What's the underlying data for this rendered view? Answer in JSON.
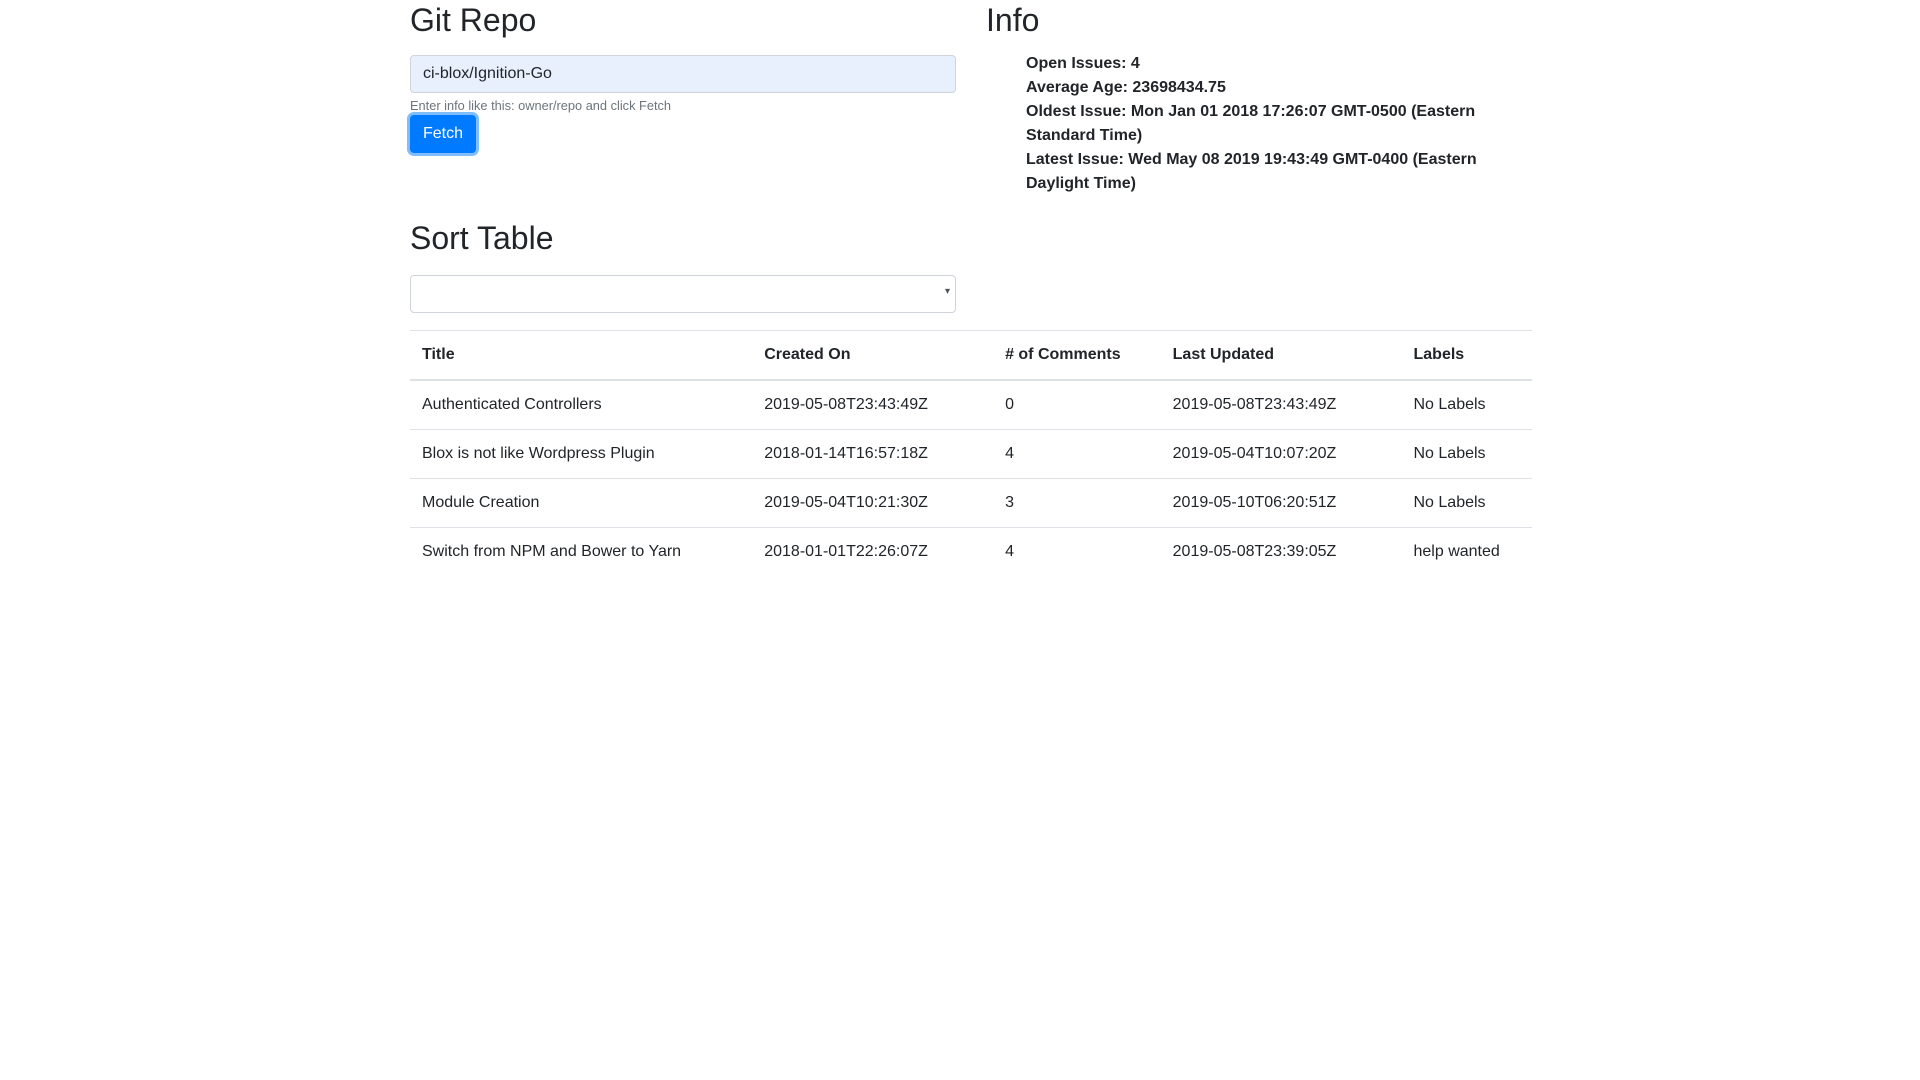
{
  "repo": {
    "title": "Git Repo",
    "input_value": "ci-blox/Ignition-Go",
    "help_text": "Enter info like this: owner/repo and click Fetch",
    "fetch_label": "Fetch"
  },
  "info": {
    "title": "Info",
    "open_issues": "Open Issues: 4",
    "average_age": "Average Age: 23698434.75",
    "oldest_issue": "Oldest Issue: Mon Jan 01 2018 17:26:07 GMT-0500 (Eastern Standard Time)",
    "latest_issue": "Latest Issue: Wed May 08 2019 19:43:49 GMT-0400 (Eastern Daylight Time)"
  },
  "sort": {
    "title": "Sort Table",
    "selected": ""
  },
  "table": {
    "headers": [
      "Title",
      "Created On",
      "# of Comments",
      "Last Updated",
      "Labels"
    ],
    "rows": [
      [
        "Authenticated Controllers",
        "2019-05-08T23:43:49Z",
        "0",
        "2019-05-08T23:43:49Z",
        "No Labels"
      ],
      [
        "Blox is not like Wordpress Plugin",
        "2018-01-14T16:57:18Z",
        "4",
        "2019-05-04T10:07:20Z",
        "No Labels"
      ],
      [
        "Module Creation",
        "2019-05-04T10:21:30Z",
        "3",
        "2019-05-10T06:20:51Z",
        "No Labels"
      ],
      [
        "Switch from NPM and Bower to Yarn",
        "2018-01-01T22:26:07Z",
        "4",
        "2019-05-08T23:39:05Z",
        "help wanted"
      ]
    ]
  },
  "colors": {
    "primary": "#007bff",
    "autofill_bg": "#e8f0fe",
    "text": "#212529",
    "muted": "#6c757d",
    "border": "#dee2e6"
  },
  "icons": {
    "select_arrow": "chevron-down-icon"
  }
}
